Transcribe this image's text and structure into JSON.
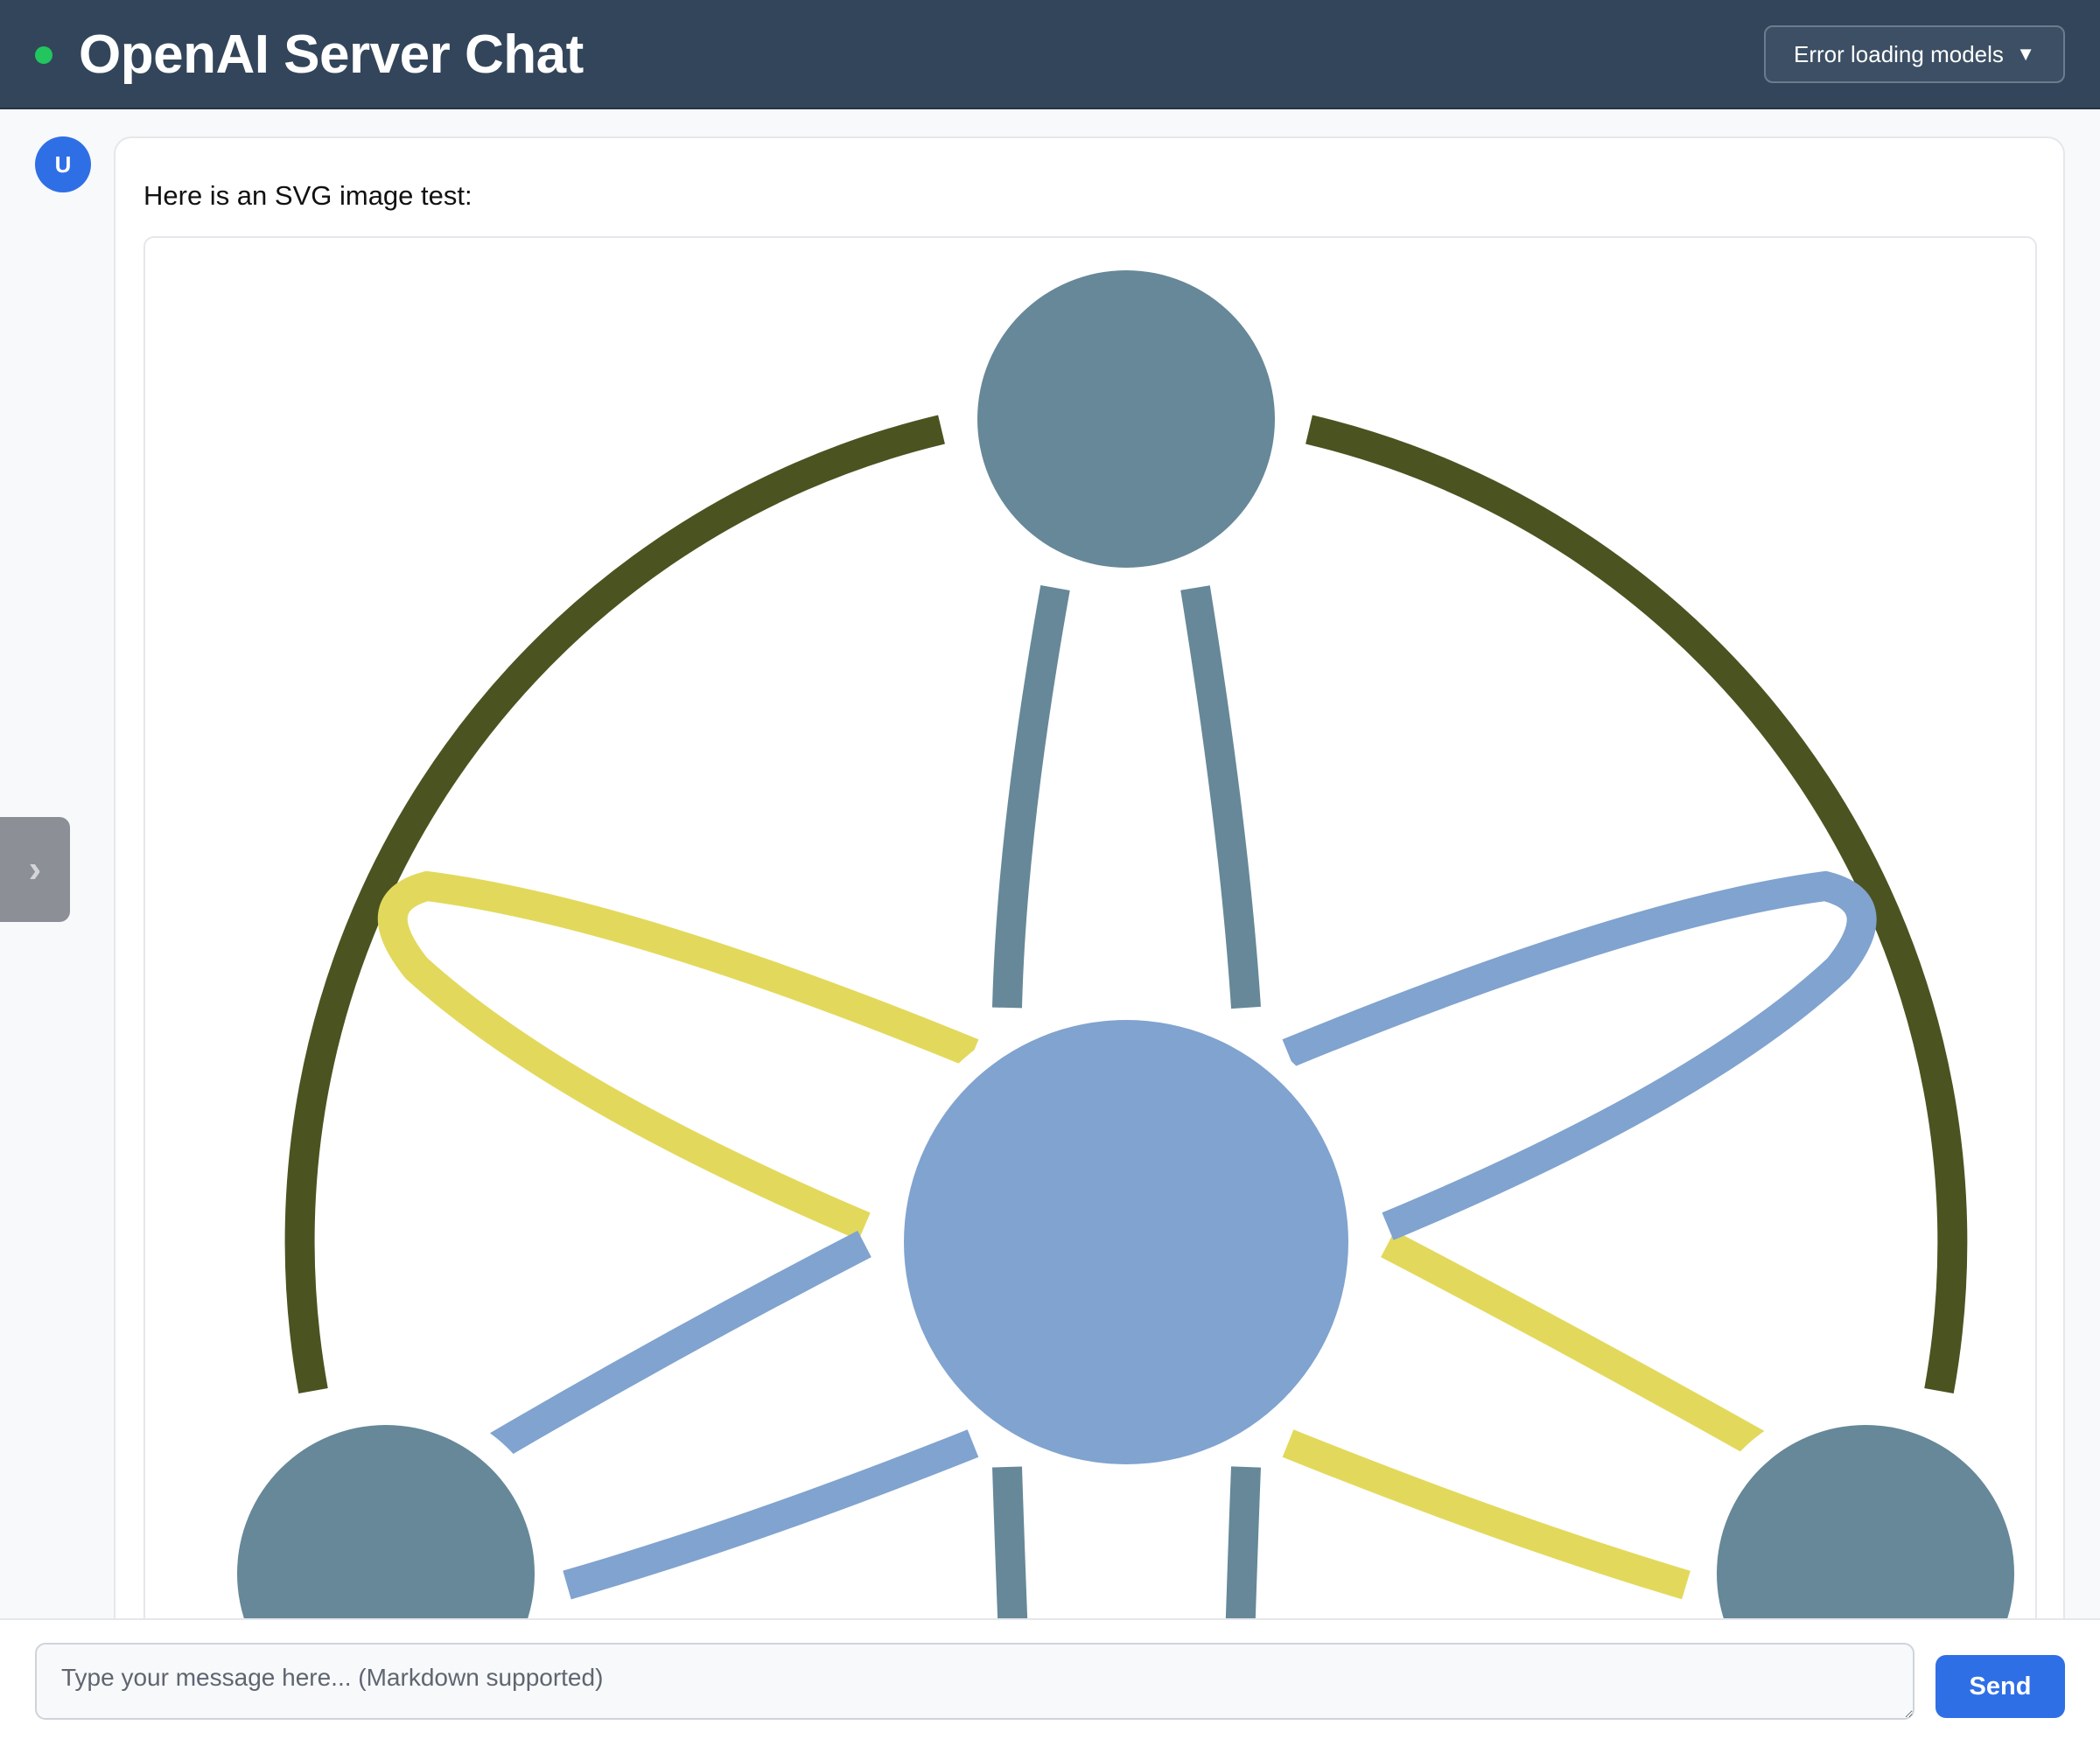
{
  "header": {
    "title": "OpenAI Server Chat",
    "status_color": "#22c55e",
    "model_select_label": "Error loading models",
    "model_select_icon": "chevron-down-icon"
  },
  "sidebar_toggle": {
    "icon": "chevron-right-icon",
    "glyph": "›"
  },
  "message": {
    "avatar_initial": "U",
    "text": "Here is an SVG image test:",
    "image": {
      "colors": {
        "outer_arc": "#4b5320",
        "outer_node": "#668899",
        "center_node": "#80a3cf",
        "link_yellow": "#e2d95c",
        "link_blue": "#80a3cf",
        "link_gray": "#668899"
      }
    }
  },
  "composer": {
    "placeholder": "Type your message here... (Markdown supported)",
    "send_label": "Send"
  }
}
